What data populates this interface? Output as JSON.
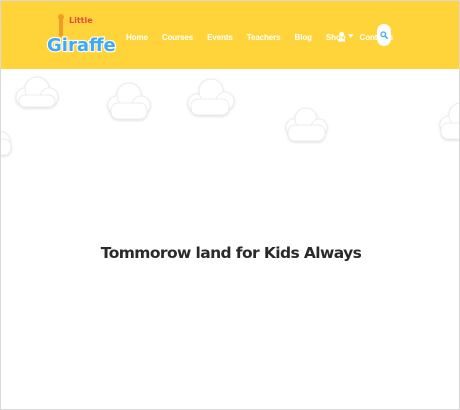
{
  "header": {
    "background": "#ffd43b",
    "logo": {
      "line1": "Little",
      "line2": "Giraffe",
      "icon": "giraffe-logo"
    },
    "nav": {
      "items": [
        {
          "label": "Home"
        },
        {
          "label": "Courses"
        },
        {
          "label": "Events"
        },
        {
          "label": "Teachers"
        },
        {
          "label": "Blog"
        },
        {
          "label": "Shop"
        },
        {
          "label": "Contacts"
        }
      ]
    },
    "user_menu": {
      "icon": "user-icon",
      "caret": "caret-down-icon"
    },
    "search": {
      "icon": "search-icon",
      "accent": "#3fa9f5"
    }
  },
  "hero": {
    "title": "Tommorow land for Kids Always"
  }
}
